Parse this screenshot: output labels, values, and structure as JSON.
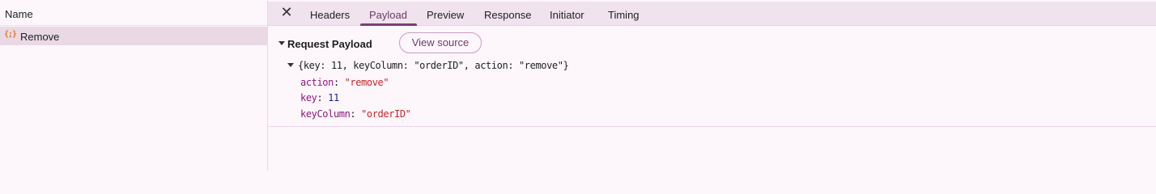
{
  "list": {
    "header": "Name",
    "requests": [
      {
        "icon": "json-icon",
        "icon_glyph": "{;}",
        "name": "Remove"
      }
    ]
  },
  "tabs": {
    "close_glyph": "✕",
    "items": [
      {
        "label": "Headers",
        "active": false
      },
      {
        "label": "Payload",
        "active": true
      },
      {
        "label": "Preview",
        "active": false
      },
      {
        "label": "Response",
        "active": false
      },
      {
        "label": "Initiator",
        "active": false
      },
      {
        "label": "Timing",
        "active": false
      }
    ]
  },
  "payload": {
    "section_title": "Request Payload",
    "view_source_label": "View source",
    "summary": "{key: 11, keyColumn: \"orderID\", action: \"remove\"}",
    "properties": [
      {
        "key": "action",
        "value": "\"remove\"",
        "type": "string"
      },
      {
        "key": "key",
        "value": "11",
        "type": "number"
      },
      {
        "key": "keyColumn",
        "value": "\"orderID\"",
        "type": "string"
      }
    ]
  },
  "colors": {
    "accent": "#7b3d77",
    "string_value": "#c0262d",
    "number_value": "#1a1aa6",
    "property_key": "#8a1a7a",
    "selected_row": "#ead9e5",
    "tabbar_bg": "#f0e3ee"
  }
}
